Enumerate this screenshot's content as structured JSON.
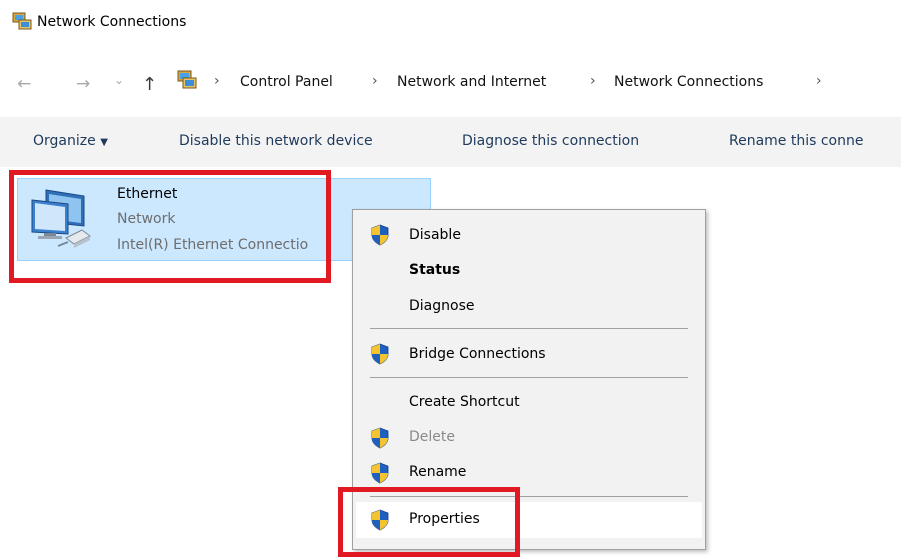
{
  "window": {
    "title": "Network Connections",
    "icon": "network-connections-icon"
  },
  "address_bar": {
    "nav": {
      "back": "←",
      "forward": "→",
      "recent": "⌄",
      "up": "↑"
    },
    "separator": "›",
    "crumbs": [
      "Control Panel",
      "Network and Internet",
      "Network Connections"
    ]
  },
  "toolbar": {
    "organize": "Organize",
    "organize_arrow": "▼",
    "disable": "Disable this network device",
    "diagnose": "Diagnose this connection",
    "rename": "Rename this conne"
  },
  "connection": {
    "name": "Ethernet",
    "status": "Network",
    "device": "Intel(R) Ethernet Connectio",
    "icon": "ethernet-adapter-icon"
  },
  "context_menu": {
    "items": [
      {
        "label": "Disable",
        "icon": "uac-shield-icon"
      },
      {
        "label": "Status",
        "bold": true
      },
      {
        "label": "Diagnose"
      },
      {
        "label": "Bridge Connections",
        "icon": "uac-shield-icon"
      },
      {
        "label": "Create Shortcut"
      },
      {
        "label": "Delete",
        "icon": "uac-shield-icon",
        "disabled": true
      },
      {
        "label": "Rename",
        "icon": "uac-shield-icon"
      },
      {
        "label": "Properties",
        "icon": "uac-shield-icon",
        "highlighted": true
      }
    ]
  },
  "colors": {
    "selection_bg": "#cce8ff",
    "selection_border": "#99d1ff",
    "highlight_red": "#e11922",
    "toolbar_text": "#1e395b",
    "menu_bg": "#f2f2f2"
  }
}
